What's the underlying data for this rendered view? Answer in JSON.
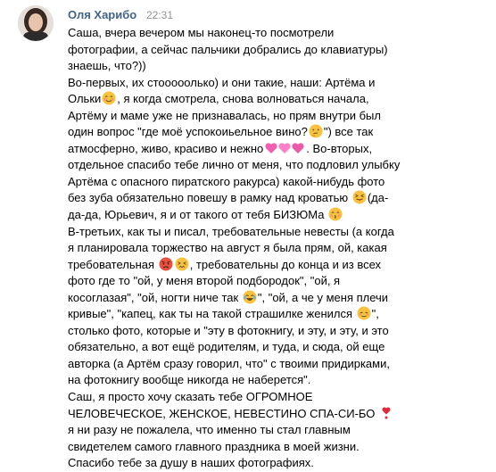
{
  "message": {
    "author": "Оля Харибо",
    "time": "22:31",
    "lines": [
      "Саша, вчера вечером мы наконец-то посмотрели",
      "фотографии, а сейчас пальчики добрались до клавиатуры)",
      "знаешь, что?))",
      "Во-первых, их стооооолько) и они такие, наши: Артёма и",
      "Ольки",
      ", я когда смотрела, снова волноваться начала,",
      "Артёму и маме уже не признавалась, но прям внутри был",
      "один вопрос \"где моё успокоиьельное вино?",
      "\") все так",
      "атмосферно, живо, красиво и нежно",
      ". Во-вторых,",
      "отдельное спасибо тебе лично от меня, что подловил улыбку",
      "Артёма с опасного пиратского ракурса) какой-нибудь фото",
      "без зуба обязательно повешу в рамку над кроватью",
      "(да-",
      "да-да, Юрьевич, я и от такого от тебя БИЗЮМа",
      "В-третьих, как ты и писал, требовательные невесты (а когда",
      "я планировала торжество на август я была прям, ой, какая",
      "требовательная",
      ", требовательны до конца и из всех",
      "фото где то \"ой, у меня второй подбородок\", \"ой, я",
      "косоглазая\", \"ой, ногти ниче так",
      "\", \"ой, а че у меня плечи",
      "кривые\", \"капец, как ты на такой страшилке женился",
      "\",",
      "столько фото, которые и \"эту в фотокнигу, и эту, и эту, и это",
      "обязательно, а вот ещё родителям, и туда, и сюда, ой еще",
      "авторка (а Артём сразу говорил, что\" с твоими придирками,",
      "на фотокнигу вообще никогда не наберется\".",
      "Саш, я просто хочу сказать тебе ОГРОМНОЕ",
      "ЧЕЛОВЕЧЕСКОЕ, ЖЕНСКОЕ, НЕВЕСТИНО СПА-СИ-БО",
      "я ни разу не пожалела, что именно ты стал главным",
      "свидетелем самого главного праздника в моей жизни.",
      "Спасибо тебе за душу в наших фотографиях."
    ]
  },
  "colors": {
    "author": "#42648b",
    "time": "#939393",
    "text": "#000000"
  },
  "emoji_icons": [
    "blush-emoji-icon",
    "thinking-emoji-icon",
    "hearts-emoji-icon",
    "squint-tongue-emoji-icon",
    "kiss-emoji-icon",
    "angry-emoji-icon",
    "persevere-emoji-icon",
    "laughing-tears-emoji-icon",
    "relieved-emoji-icon",
    "heart-exclamation-emoji-icon"
  ]
}
